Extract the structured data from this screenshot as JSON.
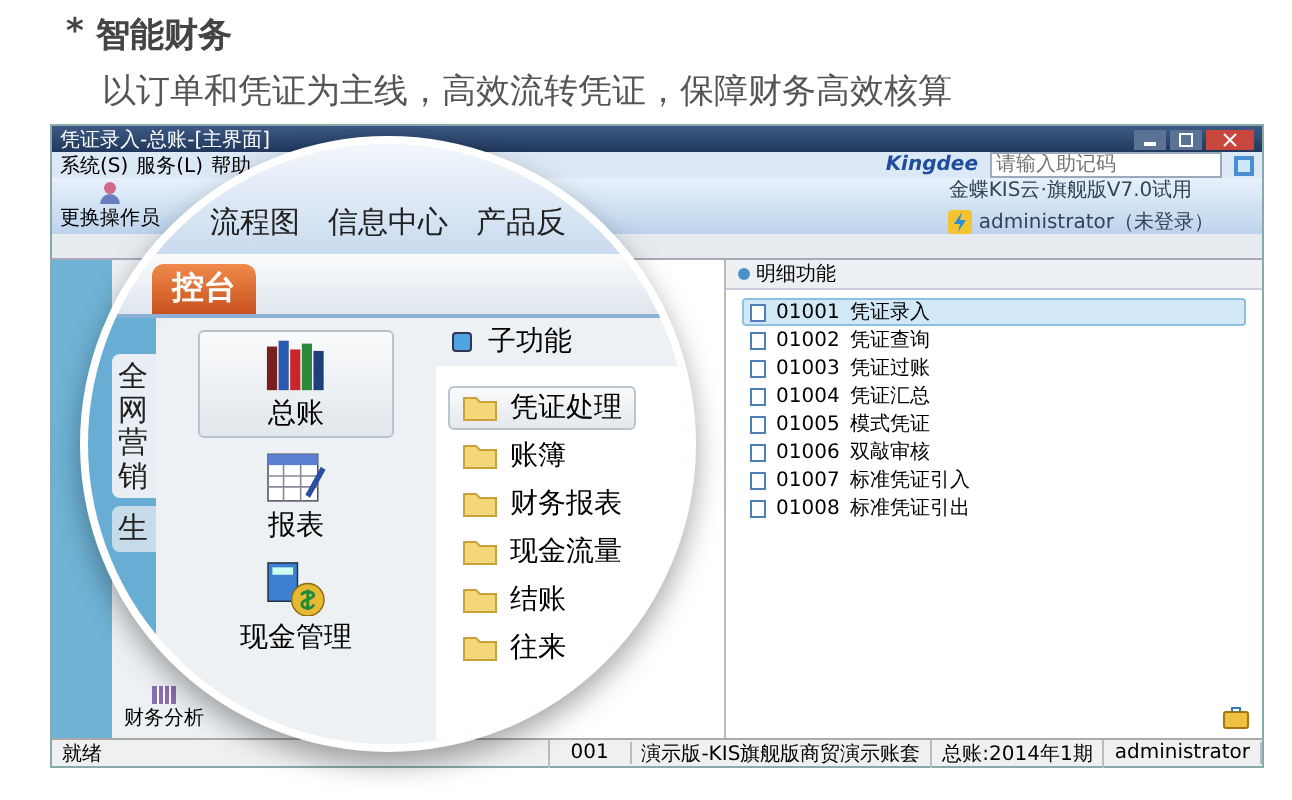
{
  "heading": {
    "mark": "*",
    "title": "智能财务",
    "subtitle": "以订单和凭证为主线，高效流转凭证，保障财务高效核算"
  },
  "window": {
    "title": "凭证录入-总账-[主界面]",
    "menus": [
      "系统(S)",
      "服务(L)",
      "帮助"
    ],
    "toolbar": [
      "更换操作员"
    ],
    "brand": "Kingdee",
    "search": {
      "placeholder": "请输入助记码"
    },
    "edition": "金蝶KIS云·旗舰版V7.0试用",
    "user": "administrator（未登录）"
  },
  "nav_bottom": {
    "label": "财务分析"
  },
  "detail": {
    "title": "明细功能",
    "items": [
      {
        "code": "01001",
        "label": "凭证录入",
        "selected": true
      },
      {
        "code": "01002",
        "label": "凭证查询",
        "selected": false
      },
      {
        "code": "01003",
        "label": "凭证过账",
        "selected": false
      },
      {
        "code": "01004",
        "label": "凭证汇总",
        "selected": false
      },
      {
        "code": "01005",
        "label": "模式凭证",
        "selected": false
      },
      {
        "code": "01006",
        "label": "双敲审核",
        "selected": false
      },
      {
        "code": "01007",
        "label": "标准凭证引入",
        "selected": false
      },
      {
        "code": "01008",
        "label": "标准凭证引出",
        "selected": false
      }
    ]
  },
  "status_bar": [
    "就绪",
    "001",
    "演示版-KIS旗舰版商贸演示账套",
    "总账:2014年1期",
    "administrator"
  ],
  "lens": {
    "menus": [
      "流程图",
      "信息中心",
      "产品反"
    ],
    "tab": "控台",
    "side_tabs": [
      {
        "label": "全网营销",
        "selected": true
      },
      {
        "label": "生",
        "selected": false
      }
    ],
    "nav": [
      {
        "label": "总账",
        "kind": "books",
        "selected": true
      },
      {
        "label": "报表",
        "kind": "report",
        "selected": false
      },
      {
        "label": "现金管理",
        "kind": "cash",
        "selected": false
      }
    ],
    "sub_title": "子功能",
    "folders": [
      {
        "label": "凭证处理",
        "selected": true
      },
      {
        "label": "账簿",
        "selected": false
      },
      {
        "label": "财务报表",
        "selected": false
      },
      {
        "label": "现金流量",
        "selected": false
      },
      {
        "label": "结账",
        "selected": false
      },
      {
        "label": "往来",
        "selected": false
      }
    ]
  }
}
